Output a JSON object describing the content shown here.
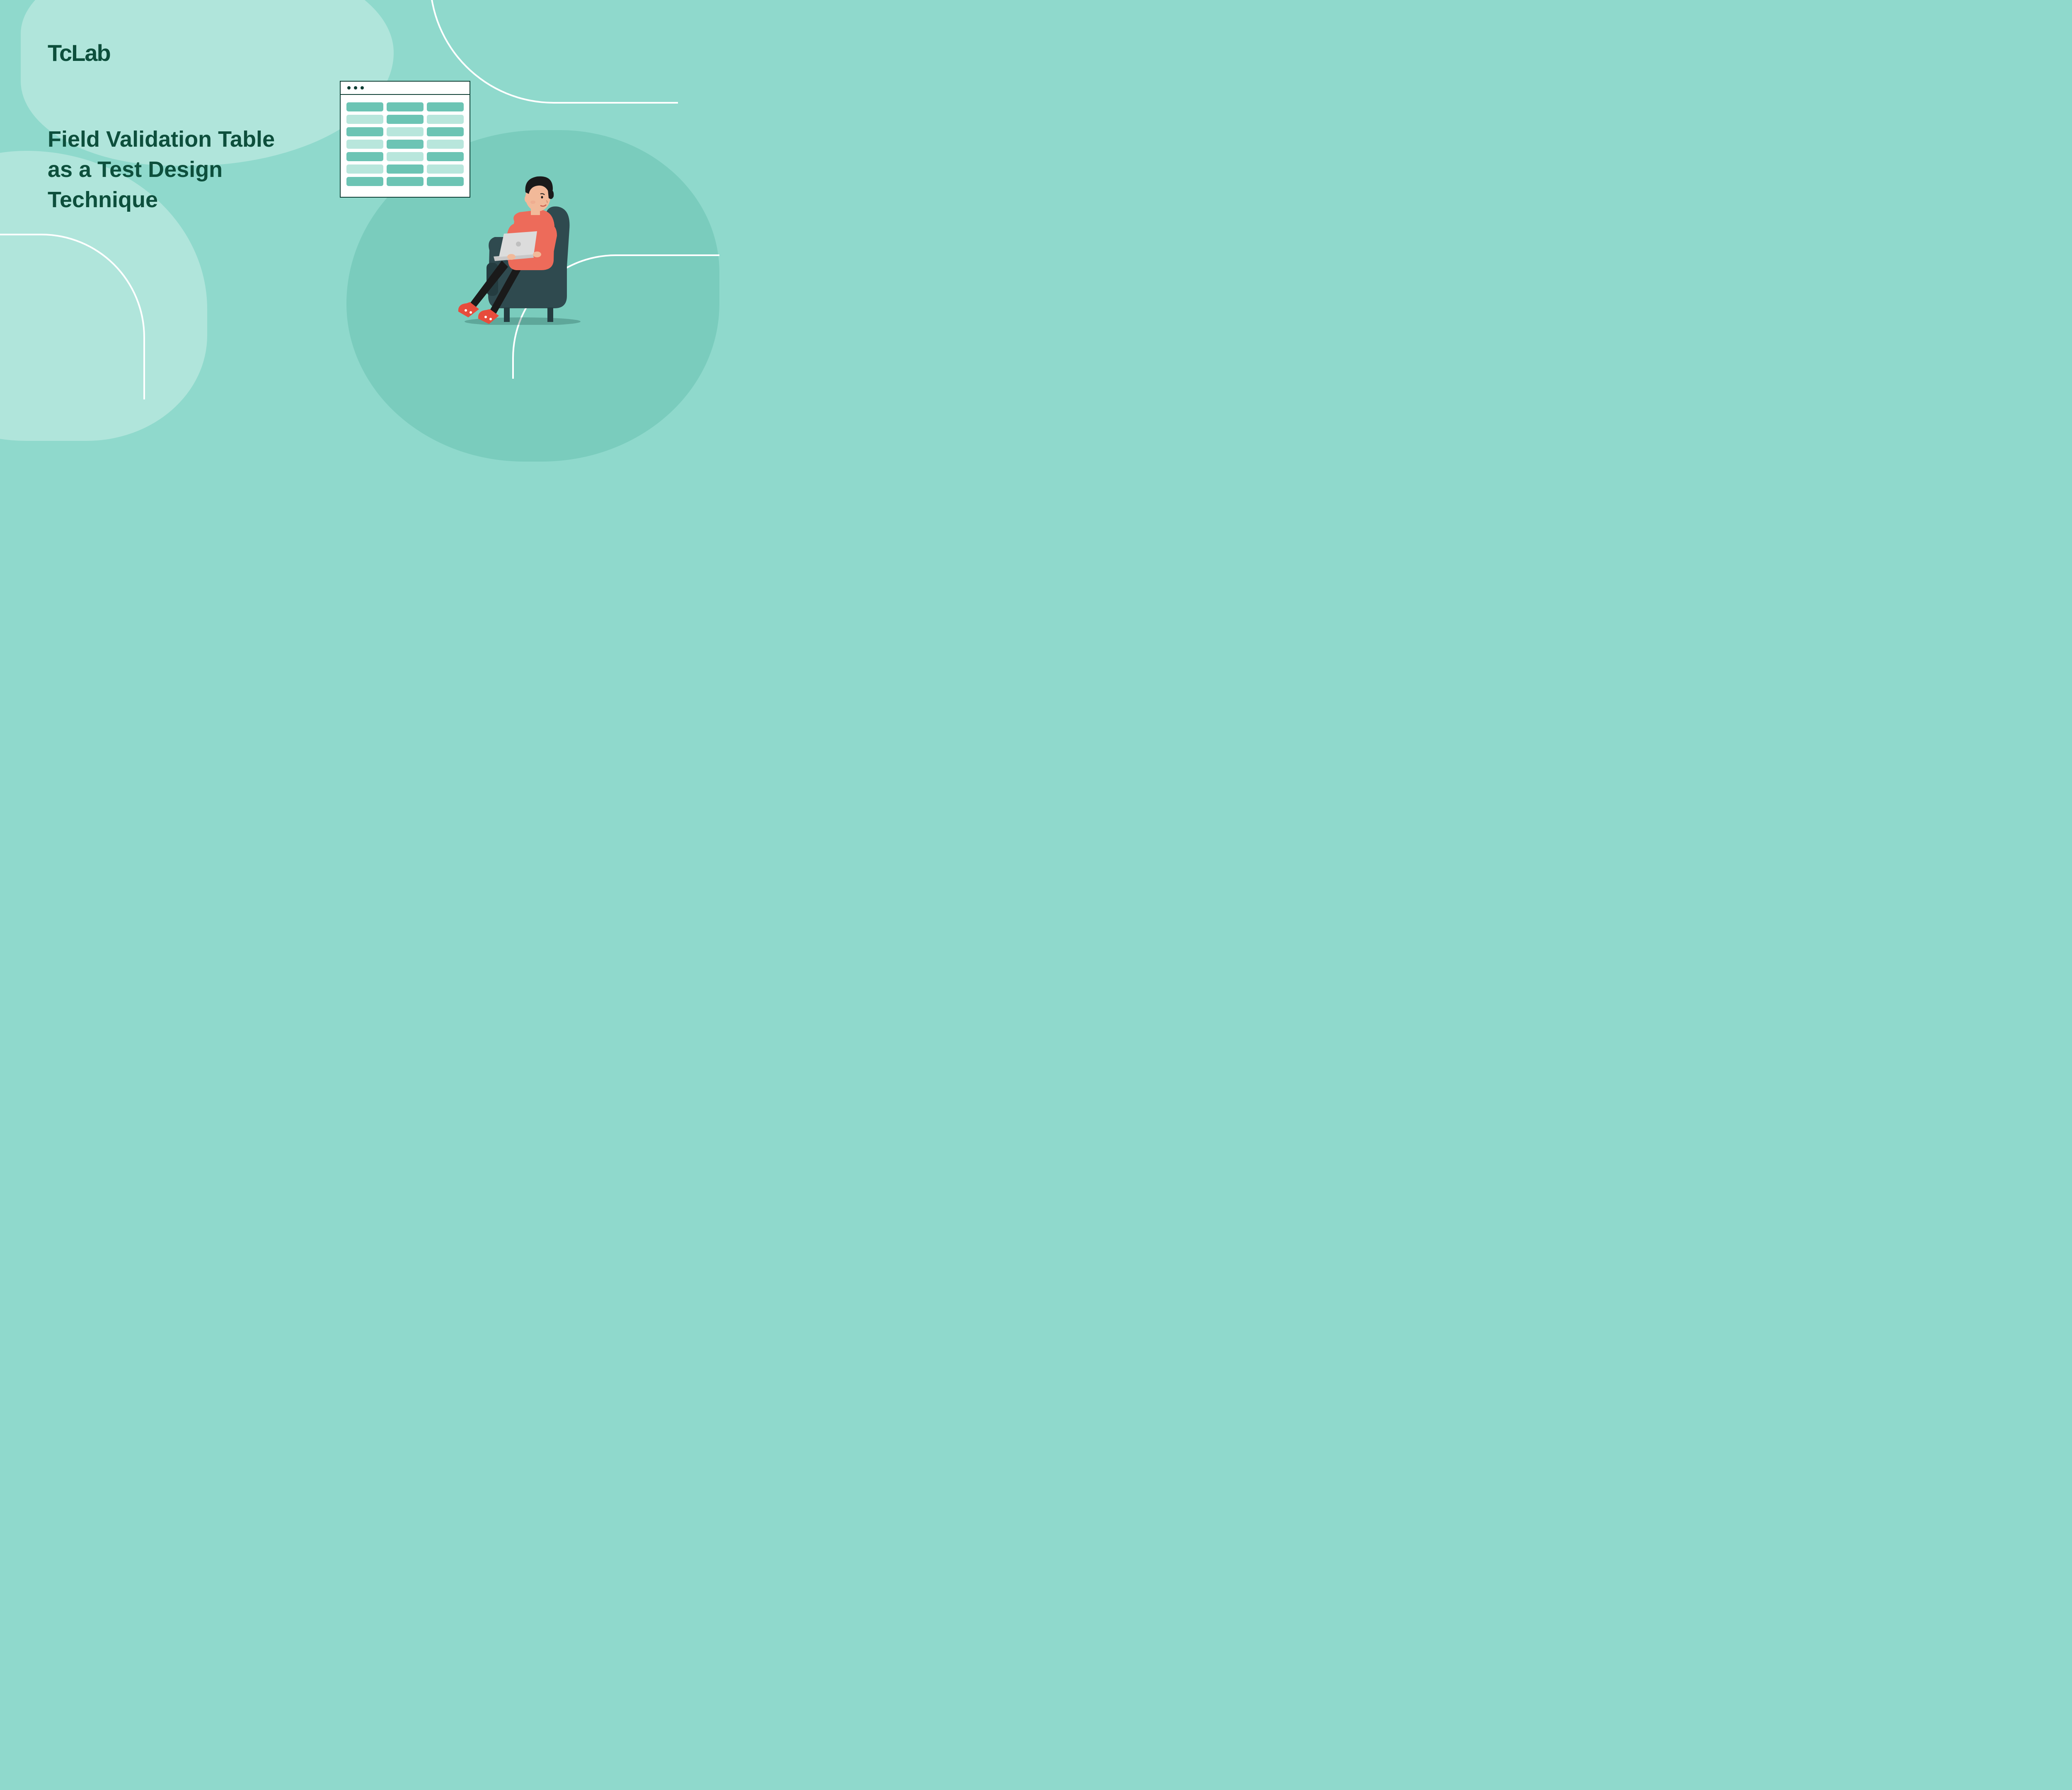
{
  "logo": "TcLab",
  "title": "Field Validation Table as a Test Design Technique",
  "window": {
    "rows": [
      [
        "d",
        "d",
        "d"
      ],
      [
        "l",
        "d",
        "l"
      ],
      [
        "d",
        "l",
        "d"
      ],
      [
        "l",
        "d",
        "l"
      ],
      [
        "d",
        "l",
        "d"
      ],
      [
        "l",
        "d",
        "l"
      ],
      [
        "d",
        "d",
        "d"
      ]
    ]
  },
  "colors": {
    "bg": "#8fd9cc",
    "blob_light": "#b0e5db",
    "blob_dark": "#7accbd",
    "brand": "#0d4f3c"
  }
}
